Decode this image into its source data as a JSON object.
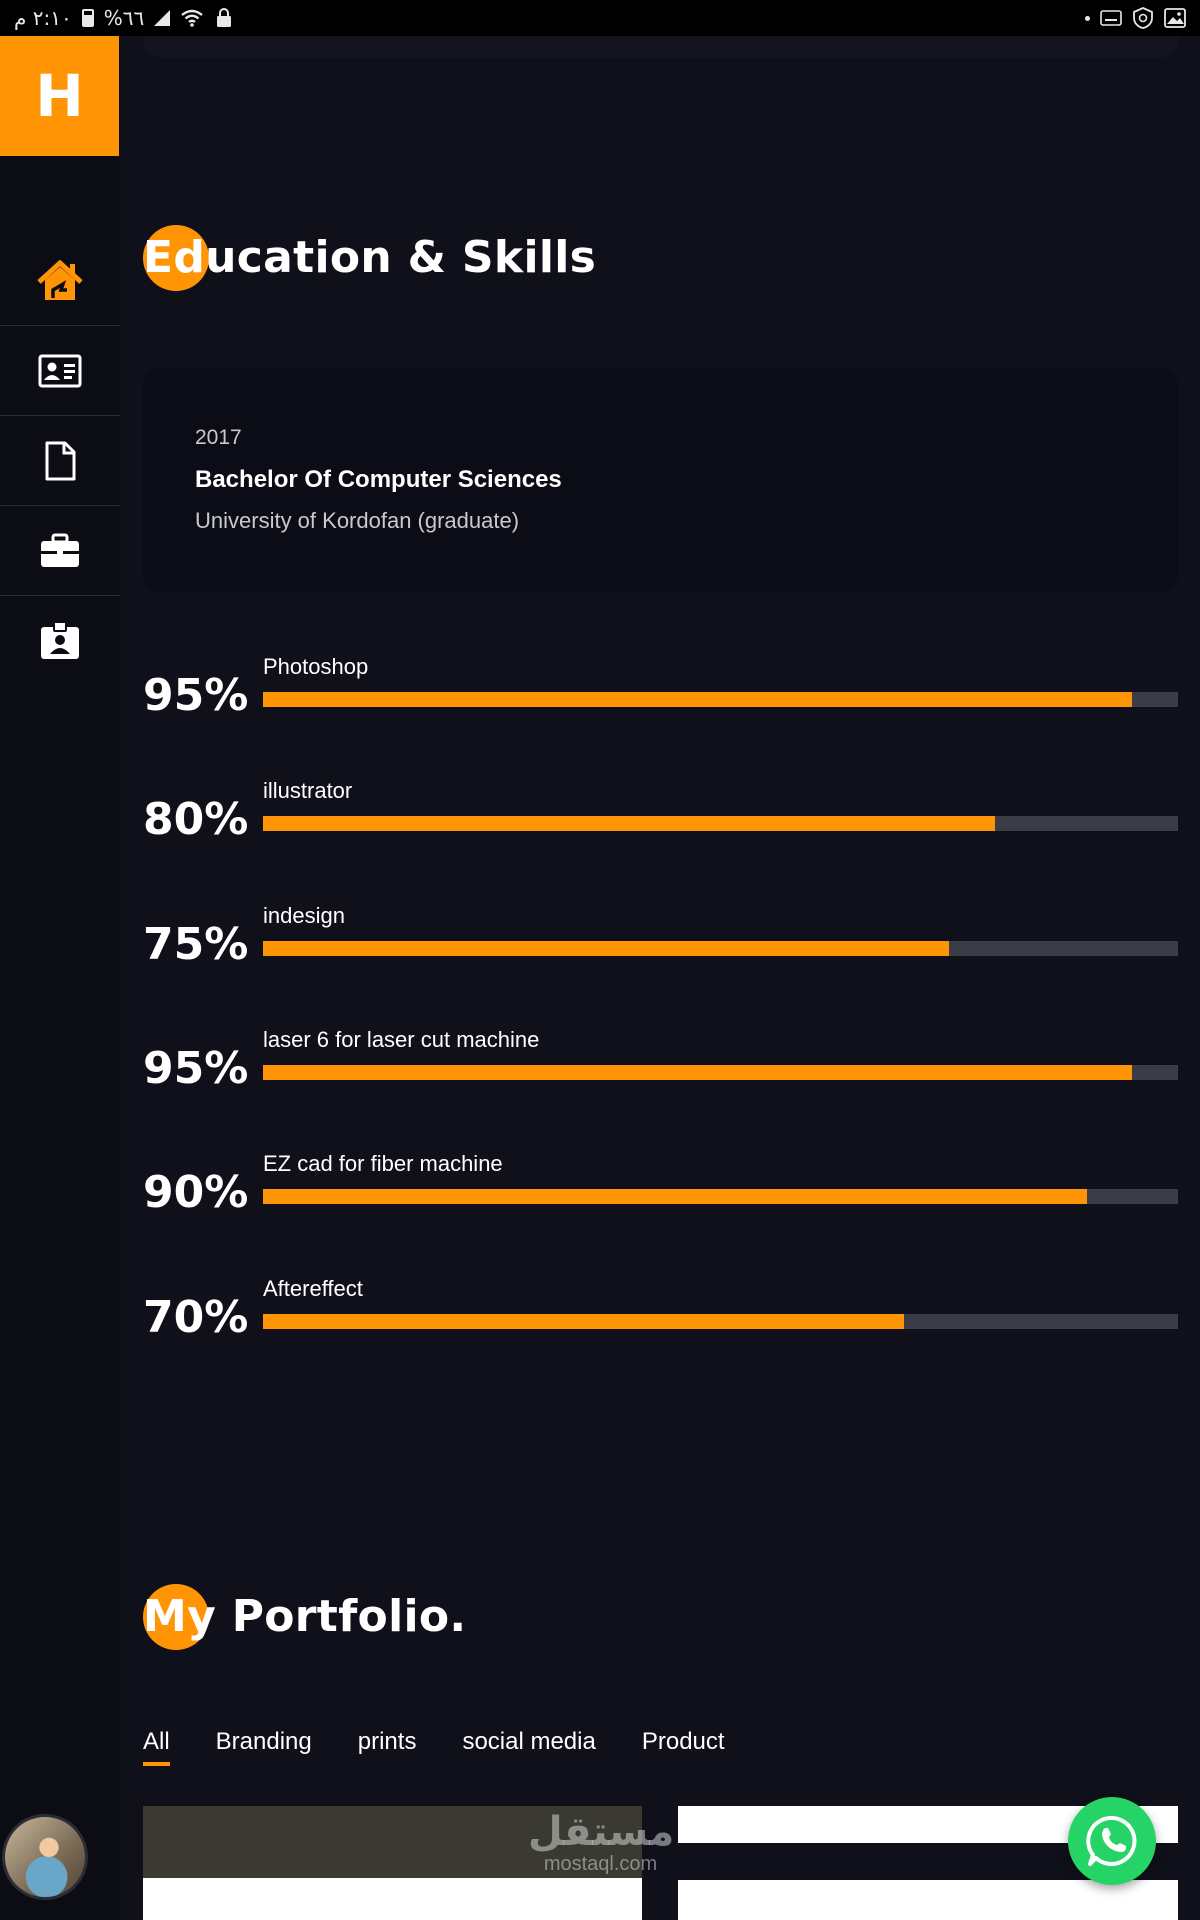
{
  "status_bar": {
    "time": "٢:١٠ م",
    "battery": "%٦٦"
  },
  "sidebar": {
    "logo_letter": "H",
    "items": [
      {
        "icon": "home-icon",
        "active": true
      },
      {
        "icon": "id-card-icon"
      },
      {
        "icon": "document-icon"
      },
      {
        "icon": "briefcase-icon"
      },
      {
        "icon": "contact-badge-icon"
      }
    ]
  },
  "education": {
    "title": "Education & Skills",
    "entries": [
      {
        "year": "2017",
        "degree": "Bachelor Of Computer Sciences",
        "school": "University of Kordofan (graduate)"
      }
    ]
  },
  "skills": [
    {
      "percent_label": "95%",
      "name": "Photoshop",
      "value": 95
    },
    {
      "percent_label": "80%",
      "name": "illustrator",
      "value": 80
    },
    {
      "percent_label": "75%",
      "name": "indesign",
      "value": 75
    },
    {
      "percent_label": "95%",
      "name": "laser 6 for laser cut machine",
      "value": 95
    },
    {
      "percent_label": "90%",
      "name": "EZ cad for fiber machine",
      "value": 90
    },
    {
      "percent_label": "70%",
      "name": "Aftereffect",
      "value": 70
    }
  ],
  "portfolio": {
    "title_highlight": "My",
    "title_rest": "Portfolio.",
    "tabs": [
      "All",
      "Branding",
      "prints",
      "social media",
      "Product"
    ],
    "active_tab": "All"
  },
  "watermark": {
    "line1": "مستقل",
    "line2": "mostaql.com"
  },
  "colors": {
    "accent": "#ff9505",
    "background": "#0f101a",
    "whatsapp": "#25d366"
  }
}
